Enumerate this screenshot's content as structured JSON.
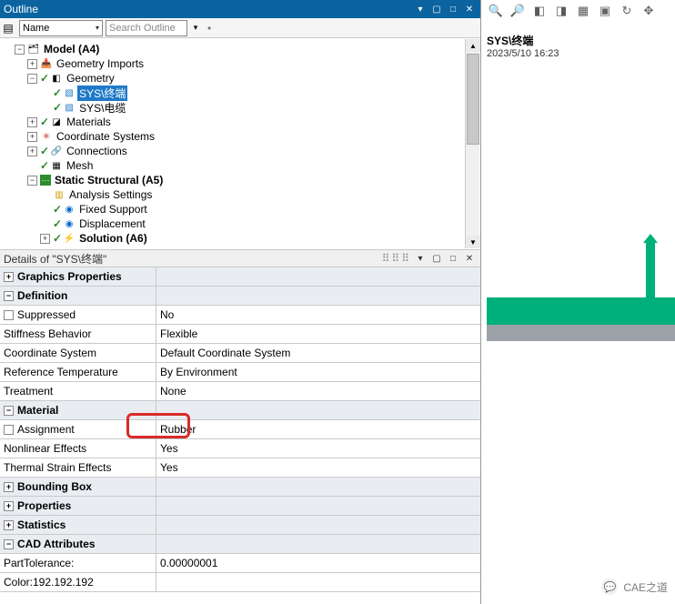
{
  "outline": {
    "panel_title": "Outline",
    "sort_label": "Name",
    "search_placeholder": "Search Outline",
    "tree": {
      "root": "Model (A4)",
      "n_geom_imports": "Geometry Imports",
      "n_geometry": "Geometry",
      "n_sys_term": "SYS\\终端",
      "n_sys_cable": "SYS\\电缆",
      "n_materials": "Materials",
      "n_coord": "Coordinate Systems",
      "n_conn": "Connections",
      "n_mesh": "Mesh",
      "n_static": "Static Structural (A5)",
      "n_analysis": "Analysis Settings",
      "n_fixed": "Fixed Support",
      "n_disp": "Displacement",
      "n_solution": "Solution (A6)"
    }
  },
  "details": {
    "panel_title": "Details of \"SYS\\终端\"",
    "cat_graphics": "Graphics Properties",
    "cat_definition": "Definition",
    "suppressed_label": "Suppressed",
    "suppressed_val": "No",
    "stiffness_label": "Stiffness Behavior",
    "stiffness_val": "Flexible",
    "coord_label": "Coordinate System",
    "coord_val": "Default Coordinate System",
    "reftemp_label": "Reference Temperature",
    "reftemp_val": "By Environment",
    "treatment_label": "Treatment",
    "treatment_val": "None",
    "cat_material": "Material",
    "assignment_label": "Assignment",
    "assignment_val": "Rubber",
    "nonlinear_label": "Nonlinear Effects",
    "nonlinear_val": "Yes",
    "thermal_label": "Thermal Strain Effects",
    "thermal_val": "Yes",
    "cat_bbox": "Bounding Box",
    "cat_props": "Properties",
    "cat_stats": "Statistics",
    "cat_cad": "CAD Attributes",
    "parttol_label": "PartTolerance:",
    "parttol_val": "0.00000001",
    "color_label": "Color:192.192.192"
  },
  "viewer": {
    "title": "SYS\\终端",
    "timestamp": "2023/5/10 16:23",
    "watermark": "CAE之道"
  }
}
